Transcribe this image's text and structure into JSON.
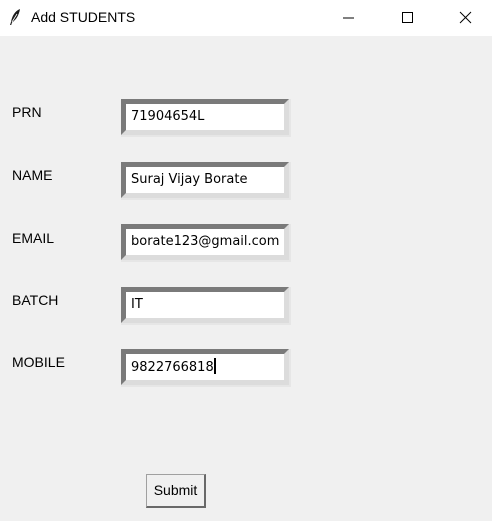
{
  "window": {
    "title": "Add STUDENTS",
    "icon": "feather-icon"
  },
  "form": {
    "fields": [
      {
        "label": "PRN",
        "value": "71904654L"
      },
      {
        "label": "NAME",
        "value": "Suraj Vijay Borate"
      },
      {
        "label": "EMAIL",
        "value": "borate123@gmail.com"
      },
      {
        "label": "BATCH",
        "value": "IT"
      },
      {
        "label": "MOBILE",
        "value": "9822766818"
      }
    ],
    "submit_label": "Submit"
  },
  "colors": {
    "titlebar": "#ffffff",
    "background": "#f0f0f0",
    "entry_shadow": "#7a7a7a"
  }
}
